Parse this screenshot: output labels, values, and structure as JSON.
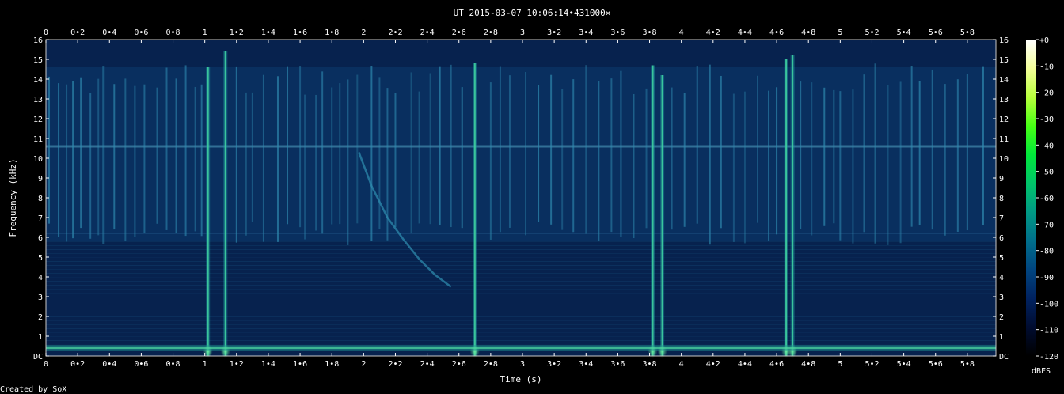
{
  "chart_data": {
    "type": "heatmap",
    "title": "UT 2015-03-07 10:06:14•431000×",
    "xlabel": "Time (s)",
    "ylabel": "Frequency (kHz)",
    "credit": "Created by SoX",
    "xlim": [
      0,
      5.98
    ],
    "ylim": [
      0,
      16
    ],
    "x_ticks": [
      "0",
      "0•2",
      "0•4",
      "0•6",
      "0•8",
      "1",
      "1•2",
      "1•4",
      "1•6",
      "1•8",
      "2",
      "2•2",
      "2•4",
      "2•6",
      "2•8",
      "3",
      "3•2",
      "3•4",
      "3•6",
      "3•8",
      "4",
      "4•2",
      "4•4",
      "4•6",
      "4•8",
      "5",
      "5•2",
      "5•4",
      "5•6",
      "5•8"
    ],
    "y_ticks": [
      "DC",
      "1",
      "2",
      "3",
      "4",
      "5",
      "6",
      "7",
      "8",
      "9",
      "10",
      "11",
      "12",
      "13",
      "14",
      "15",
      "16"
    ],
    "colorbar": {
      "unit": "dBFS",
      "range": [
        -120,
        0
      ],
      "ticks": [
        "+0",
        "-10",
        "-20",
        "-30",
        "-40",
        "-50",
        "-60",
        "-70",
        "-80",
        "-90",
        "-100",
        "-110",
        "-120"
      ],
      "colormap": [
        "#ffffff",
        "#f4ff9a",
        "#b8ff3c",
        "#47ff14",
        "#00e83a",
        "#00c46a",
        "#009a85",
        "#006f8c",
        "#004580",
        "#002260",
        "#000c30",
        "#000000"
      ]
    },
    "background_color": "#07224e",
    "features": {
      "noise_band_kHz": [
        5.8,
        14.6
      ],
      "carrier_tone_kHz": 10.6,
      "low_hum_kHz": [
        0.25,
        0.55
      ],
      "strong_impulses": [
        {
          "t": 1.02,
          "f_top": 14.6
        },
        {
          "t": 1.13,
          "f_top": 15.4
        },
        {
          "t": 2.7,
          "f_top": 14.8
        },
        {
          "t": 3.82,
          "f_top": 14.7
        },
        {
          "t": 3.88,
          "f_top": 14.2
        },
        {
          "t": 4.66,
          "f_top": 15.0
        },
        {
          "t": 4.7,
          "f_top": 15.2
        }
      ],
      "weak_impulses_t": [
        0.02,
        0.08,
        0.13,
        0.17,
        0.22,
        0.28,
        0.33,
        0.36,
        0.43,
        0.5,
        0.56,
        0.62,
        0.7,
        0.76,
        0.82,
        0.88,
        0.94,
        0.98,
        1.2,
        1.26,
        1.3,
        1.37,
        1.46,
        1.52,
        1.6,
        1.63,
        1.7,
        1.74,
        1.8,
        1.85,
        1.9,
        1.96,
        2.05,
        2.1,
        2.15,
        2.2,
        2.3,
        2.35,
        2.42,
        2.48,
        2.55,
        2.62,
        2.8,
        2.86,
        2.92,
        3.02,
        3.1,
        3.18,
        3.25,
        3.32,
        3.4,
        3.48,
        3.56,
        3.62,
        3.7,
        3.78,
        3.94,
        4.02,
        4.1,
        4.18,
        4.25,
        4.33,
        4.4,
        4.48,
        4.55,
        4.6,
        4.75,
        4.82,
        4.9,
        4.96,
        5.0,
        5.08,
        5.15,
        5.22,
        5.3,
        5.38,
        5.45,
        5.5,
        5.58,
        5.66,
        5.74,
        5.8,
        5.9
      ],
      "whistler_sweep": [
        [
          1.97,
          10.3
        ],
        [
          2.05,
          8.6
        ],
        [
          2.15,
          7.0
        ],
        [
          2.25,
          5.9
        ],
        [
          2.35,
          4.9
        ],
        [
          2.45,
          4.1
        ],
        [
          2.55,
          3.5
        ]
      ]
    }
  }
}
